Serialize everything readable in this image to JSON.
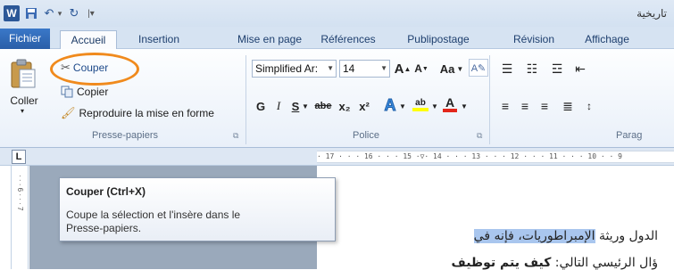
{
  "quick_access": {
    "word_icon": "word-logo-icon",
    "save_icon": "save-icon",
    "undo_icon": "undo-icon",
    "undo_dropdown": "▾",
    "redo_icon": "redo-icon",
    "customize": "|▾"
  },
  "title": "تاريخية",
  "tabs": [
    "Fichier",
    "Accueil",
    "Insertion",
    "Mise en page",
    "Références",
    "Publipostage",
    "Révision",
    "Affichage"
  ],
  "clipboard": {
    "paste_label": "Coller",
    "cut_label": "Couper",
    "copy_label": "Copier",
    "format_painter_label": "Reproduire la mise en forme",
    "group_label": "Presse-papiers"
  },
  "font": {
    "font_name": "Simplified Ar:",
    "font_size": "14",
    "grow_label": "A",
    "shrink_label": "A",
    "case_label": "Aa",
    "bold": "G",
    "italic": "I",
    "underline": "S",
    "strikethrough": "abe",
    "subscript": "x₂",
    "superscript": "x²",
    "text_effects": "A",
    "highlight": "ab",
    "font_color": "A",
    "group_label": "Police"
  },
  "paragraph": {
    "group_label": "Parag"
  },
  "ruler": {
    "tab_selector": "L",
    "marks": "· 17 · · · 16 · · · 15 ·▽· 14 · · · 13 · · · 12 · · · 11 · · · 10 · · 9"
  },
  "vruler": {
    "marks": "· · · 6 · · · 7"
  },
  "tooltip": {
    "title": "Couper (Ctrl+X)",
    "description": "Coupe la sélection et l'insère dans le Presse-papiers."
  },
  "document": {
    "line1_plain": "الدول وريثة ",
    "line1_highlight": "الإمبراطوريات، فإنه في",
    "line2_plain": "ؤال الرئيسي التالي: ",
    "line2_bold": "كيف يتم توظيف"
  },
  "colors": {
    "highlight": "#a9c6ee",
    "accent_circle": "#f08a1d",
    "file_tab": "#2a5ea8"
  }
}
